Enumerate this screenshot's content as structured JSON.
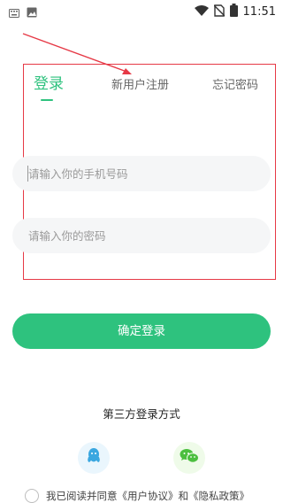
{
  "status_bar": {
    "time": "11:51",
    "icons": [
      "keyboard-icon",
      "image-icon",
      "wifi-icon",
      "no-sim-icon",
      "battery-icon"
    ]
  },
  "tabs": [
    {
      "label": "登录",
      "active": true
    },
    {
      "label": "新用户注册",
      "active": false
    },
    {
      "label": "忘记密码",
      "active": false
    }
  ],
  "form": {
    "phone_placeholder": "请输入你的手机号码",
    "password_placeholder": "请输入你的密码",
    "submit_label": "确定登录"
  },
  "third_party": {
    "title": "第三方登录方式",
    "providers": [
      "qq-icon",
      "wechat-icon"
    ]
  },
  "agreement": {
    "text": "我已阅读并同意《用户协议》和《隐私政策》",
    "checked": false
  },
  "colors": {
    "accent": "#2ec27e",
    "annotation": "#e63946",
    "qq": "#3aa7e0",
    "wechat": "#4cbf3f"
  }
}
